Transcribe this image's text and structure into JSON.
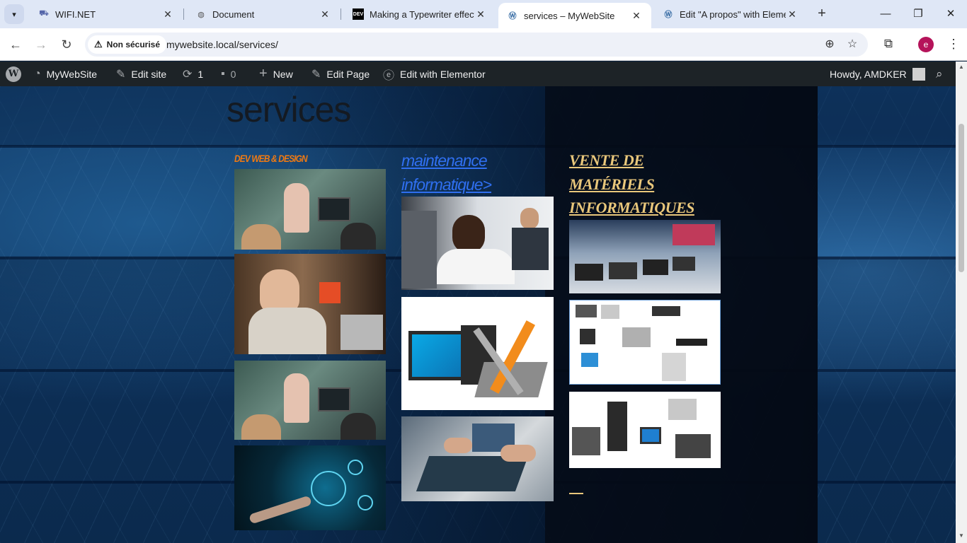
{
  "browser": {
    "tabs": [
      {
        "title": "WIFI.NET",
        "favicon": "wifi-net-icon"
      },
      {
        "title": "Document",
        "favicon": "globe-icon"
      },
      {
        "title": "Making a Typewriter effect f",
        "favicon": "dev-icon"
      },
      {
        "title": "services – MyWebSite",
        "favicon": "wordpress-icon"
      },
      {
        "title": "Edit \"A propos\" with Elemen",
        "favicon": "wordpress-icon"
      }
    ],
    "security_label": "Non sécurisé",
    "url": "mywebsite.local/services/",
    "profile_initial": "e"
  },
  "adminbar": {
    "site_name": "MyWebSite",
    "edit_site": "Edit site",
    "updates_count": "1",
    "comments_count": "0",
    "new_label": "New",
    "edit_page": "Edit Page",
    "edit_elementor": "Edit with Elementor",
    "greeting": "Howdy, AMDKER"
  },
  "page": {
    "title": "services",
    "columns": [
      {
        "heading": "DEV WEB & DESIGN",
        "images": [
          "team-coding-photo",
          "woman-laptop-html-photo",
          "team-coding-photo",
          "web-development-photo"
        ]
      },
      {
        "heading_line1": "maintenance",
        "heading_line2": "informatique>",
        "images": [
          "technician-repair-photo",
          "computer-tools-photo",
          "motherboard-repair-photo"
        ]
      },
      {
        "heading_line1": "VENTE DE",
        "heading_line2": "MATÉRIELS",
        "heading_line3": "INFORMATIQUES",
        "images": [
          "laptop-store-photo",
          "hardware-catalog-photo",
          "computer-equipment-photo"
        ]
      }
    ]
  },
  "colors": {
    "accent_orange": "#f07a12",
    "link_blue": "#2f6ff0",
    "gold": "#e9c77b",
    "adminbar": "#1d2327"
  }
}
